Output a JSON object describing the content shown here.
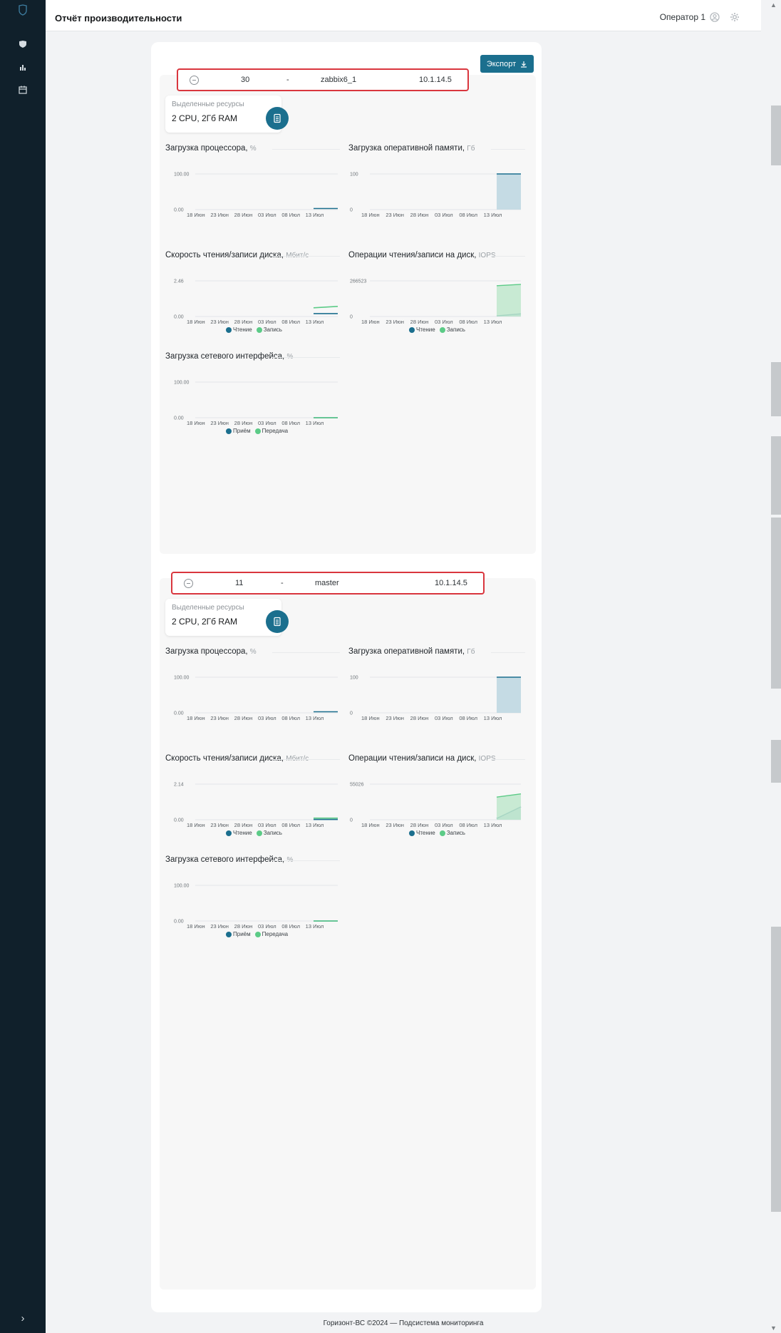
{
  "app": {
    "title": "Отчёт производительности",
    "user": "Оператор 1",
    "export_label": "Экспорт",
    "footer": "Горизонт-ВС ©2024 — Подсистема мониторинга",
    "accent_color": "#1b6f8e",
    "read_color": "#1b6f8e",
    "write_color": "#5ccb87",
    "icons": {
      "logo": "shield-logo-icon",
      "nav": [
        "shield-icon",
        "bar-chart-icon",
        "calendar-icon"
      ],
      "expand": "chevron-right-icon",
      "user": "user-circle-icon",
      "settings": "gear-icon",
      "export": "download-icon",
      "collapse": "minus-circle-icon",
      "resources": "server-icon"
    }
  },
  "vms": [
    {
      "id": "30",
      "separator": "-",
      "name": "zabbix6_1",
      "ip": "10.1.14.5",
      "resources_label": "Выделенные ресурсы",
      "resources": "2 CPU, 2Гб RAM",
      "charts": {
        "cpu": {
          "title": "Загрузка процессора,",
          "unit": "%",
          "y_ticks": [
            "100.00",
            "0.00"
          ],
          "x_ticks": [
            "18 Июн",
            "23 Июн",
            "28 Июн",
            "03 Июл",
            "08 Июл",
            "13 Июл"
          ]
        },
        "ram": {
          "title": "Загрузка оперативной памяти,",
          "unit": "Гб",
          "y_ticks": [
            "100",
            "0"
          ],
          "x_ticks": [
            "18 Июн",
            "23 Июн",
            "28 Июн",
            "03 Июл",
            "08 Июл",
            "13 Июл"
          ]
        },
        "disk_speed": {
          "title": "Скорость чтения/записи диска,",
          "unit": "Мбит/с",
          "y_ticks": [
            "2.46",
            "0.00"
          ],
          "x_ticks": [
            "18 Июн",
            "23 Июн",
            "28 Июн",
            "03 Июл",
            "08 Июл",
            "13 Июл"
          ],
          "legend": [
            "Чтение",
            "Запись"
          ]
        },
        "disk_iops": {
          "title": "Операции чтения/записи на диск,",
          "unit": "IOPS",
          "y_ticks": [
            "266523",
            "0"
          ],
          "x_ticks": [
            "18 Июн",
            "23 Июн",
            "28 Июн",
            "03 Июл",
            "08 Июл",
            "13 Июл"
          ],
          "legend": [
            "Чтение",
            "Запись"
          ]
        },
        "net": {
          "title": "Загрузка сетевого интерфейса,",
          "unit": "%",
          "y_ticks": [
            "100.00",
            "0.00"
          ],
          "x_ticks": [
            "18 Июн",
            "23 Июн",
            "28 Июн",
            "03 Июл",
            "08 Июл",
            "13 Июл"
          ],
          "legend": [
            "Приём",
            "Передача"
          ]
        }
      }
    },
    {
      "id": "11",
      "separator": "-",
      "name": "master",
      "ip": "10.1.14.5",
      "resources_label": "Выделенные ресурсы",
      "resources": "2 CPU, 2Гб RAM",
      "charts": {
        "cpu": {
          "title": "Загрузка процессора,",
          "unit": "%",
          "y_ticks": [
            "100.00",
            "0.00"
          ],
          "x_ticks": [
            "18 Июн",
            "23 Июн",
            "28 Июн",
            "03 Июл",
            "08 Июл",
            "13 Июл"
          ]
        },
        "ram": {
          "title": "Загрузка оперативной памяти,",
          "unit": "Гб",
          "y_ticks": [
            "100",
            "0"
          ],
          "x_ticks": [
            "18 Июн",
            "23 Июн",
            "28 Июн",
            "03 Июл",
            "08 Июл",
            "13 Июл"
          ]
        },
        "disk_speed": {
          "title": "Скорость чтения/записи диска,",
          "unit": "Мбит/с",
          "y_ticks": [
            "2.14",
            "0.00"
          ],
          "x_ticks": [
            "18 Июн",
            "23 Июн",
            "28 Июн",
            "03 Июл",
            "08 Июл",
            "13 Июл"
          ],
          "legend": [
            "Чтение",
            "Запись"
          ]
        },
        "disk_iops": {
          "title": "Операции чтения/записи на диск,",
          "unit": "IOPS",
          "y_ticks": [
            "55026",
            "0"
          ],
          "x_ticks": [
            "18 Июн",
            "23 Июн",
            "28 Июн",
            "03 Июл",
            "08 Июл",
            "13 Июл"
          ],
          "legend": [
            "Чтение",
            "Запись"
          ]
        },
        "net": {
          "title": "Загрузка сетевого интерфейса,",
          "unit": "%",
          "y_ticks": [
            "100.00",
            "0.00"
          ],
          "x_ticks": [
            "18 Июн",
            "23 Июн",
            "28 Июн",
            "03 Июл",
            "08 Июл",
            "13 Июл"
          ],
          "legend": [
            "Приём",
            "Передача"
          ]
        }
      }
    }
  ],
  "chart_data": [
    {
      "vm": "zabbix6_1",
      "type": "line",
      "title": "Загрузка процессора, %",
      "x": [
        "18 Июн",
        "23 Июн",
        "28 Июн",
        "03 Июл",
        "08 Июл",
        "13 Июл"
      ],
      "ylim": [
        0,
        100
      ],
      "series": [
        {
          "values": [
            null,
            null,
            null,
            null,
            null,
            3,
            3
          ]
        }
      ]
    },
    {
      "vm": "zabbix6_1",
      "type": "area",
      "title": "Загрузка оперативной памяти, Гб",
      "x": [
        "18 Июн",
        "23 Июн",
        "28 Июн",
        "03 Июл",
        "08 Июл",
        "13 Июл"
      ],
      "ylim": [
        0,
        100
      ],
      "series": [
        {
          "values": [
            null,
            null,
            null,
            null,
            null,
            100,
            100
          ]
        }
      ]
    },
    {
      "vm": "zabbix6_1",
      "type": "line",
      "title": "Скорость чтения/записи диска, Мбит/с",
      "x": [
        "18 Июн",
        "23 Июн",
        "28 Июн",
        "03 Июл",
        "08 Июл",
        "13 Июл"
      ],
      "ylim": [
        0,
        2.46
      ],
      "series": [
        {
          "name": "Чтение",
          "values": [
            null,
            null,
            null,
            null,
            null,
            0.2,
            0.2
          ]
        },
        {
          "name": "Запись",
          "values": [
            null,
            null,
            null,
            null,
            null,
            0.6,
            0.7
          ]
        }
      ]
    },
    {
      "vm": "zabbix6_1",
      "type": "area",
      "title": "Операции чтения/записи на диск, IOPS",
      "x": [
        "18 Июн",
        "23 Июн",
        "28 Июн",
        "03 Июл",
        "08 Июл",
        "13 Июл"
      ],
      "ylim": [
        0,
        266523
      ],
      "series": [
        {
          "name": "Чтение",
          "values": [
            null,
            null,
            null,
            null,
            null,
            5000,
            20000
          ]
        },
        {
          "name": "Запись",
          "values": [
            null,
            null,
            null,
            null,
            null,
            230000,
            240000
          ]
        }
      ]
    },
    {
      "vm": "zabbix6_1",
      "type": "line",
      "title": "Загрузка сетевого интерфейса, %",
      "x": [
        "18 Июн",
        "23 Июн",
        "28 Июн",
        "03 Июл",
        "08 Июл",
        "13 Июл"
      ],
      "ylim": [
        0,
        100
      ],
      "series": [
        {
          "name": "Приём",
          "values": [
            null,
            null,
            null,
            null,
            null,
            0,
            0
          ]
        },
        {
          "name": "Передача",
          "values": [
            null,
            null,
            null,
            null,
            null,
            0,
            0
          ]
        }
      ]
    },
    {
      "vm": "master",
      "type": "line",
      "title": "Загрузка процессора, %",
      "x": [
        "18 Июн",
        "23 Июн",
        "28 Июн",
        "03 Июл",
        "08 Июл",
        "13 Июл"
      ],
      "ylim": [
        0,
        100
      ],
      "series": [
        {
          "values": [
            null,
            null,
            null,
            null,
            null,
            3,
            3
          ]
        }
      ]
    },
    {
      "vm": "master",
      "type": "area",
      "title": "Загрузка оперативной памяти, Гб",
      "x": [
        "18 Июн",
        "23 Июн",
        "28 Июн",
        "03 Июл",
        "08 Июл",
        "13 Июл"
      ],
      "ylim": [
        0,
        100
      ],
      "series": [
        {
          "values": [
            null,
            null,
            null,
            null,
            null,
            100,
            100
          ]
        }
      ]
    },
    {
      "vm": "master",
      "type": "line",
      "title": "Скорость чтения/записи диска, Мбит/с",
      "x": [
        "18 Июн",
        "23 Июн",
        "28 Июн",
        "03 Июл",
        "08 Июл",
        "13 Июл"
      ],
      "ylim": [
        0,
        2.14
      ],
      "series": [
        {
          "name": "Чтение",
          "values": [
            null,
            null,
            null,
            null,
            null,
            0.02,
            0.02
          ]
        },
        {
          "name": "Запись",
          "values": [
            null,
            null,
            null,
            null,
            null,
            0.1,
            0.1
          ]
        }
      ]
    },
    {
      "vm": "master",
      "type": "area",
      "title": "Операции чтения/записи на диск, IOPS",
      "x": [
        "18 Июн",
        "23 Июн",
        "28 Июн",
        "03 Июл",
        "08 Июл",
        "13 Июл"
      ],
      "ylim": [
        0,
        55026
      ],
      "series": [
        {
          "name": "Чтение",
          "values": [
            null,
            null,
            null,
            null,
            null,
            2000,
            20000
          ]
        },
        {
          "name": "Запись",
          "values": [
            null,
            null,
            null,
            null,
            null,
            35000,
            40000
          ]
        }
      ]
    },
    {
      "vm": "master",
      "type": "line",
      "title": "Загрузка сетевого интерфейса, %",
      "x": [
        "18 Июн",
        "23 Июн",
        "28 Июн",
        "03 Июл",
        "08 Июл",
        "13 Июл"
      ],
      "ylim": [
        0,
        100
      ],
      "series": [
        {
          "name": "Приём",
          "values": [
            null,
            null,
            null,
            null,
            null,
            0,
            0
          ]
        },
        {
          "name": "Передача",
          "values": [
            null,
            null,
            null,
            null,
            null,
            0,
            0
          ]
        }
      ]
    }
  ]
}
